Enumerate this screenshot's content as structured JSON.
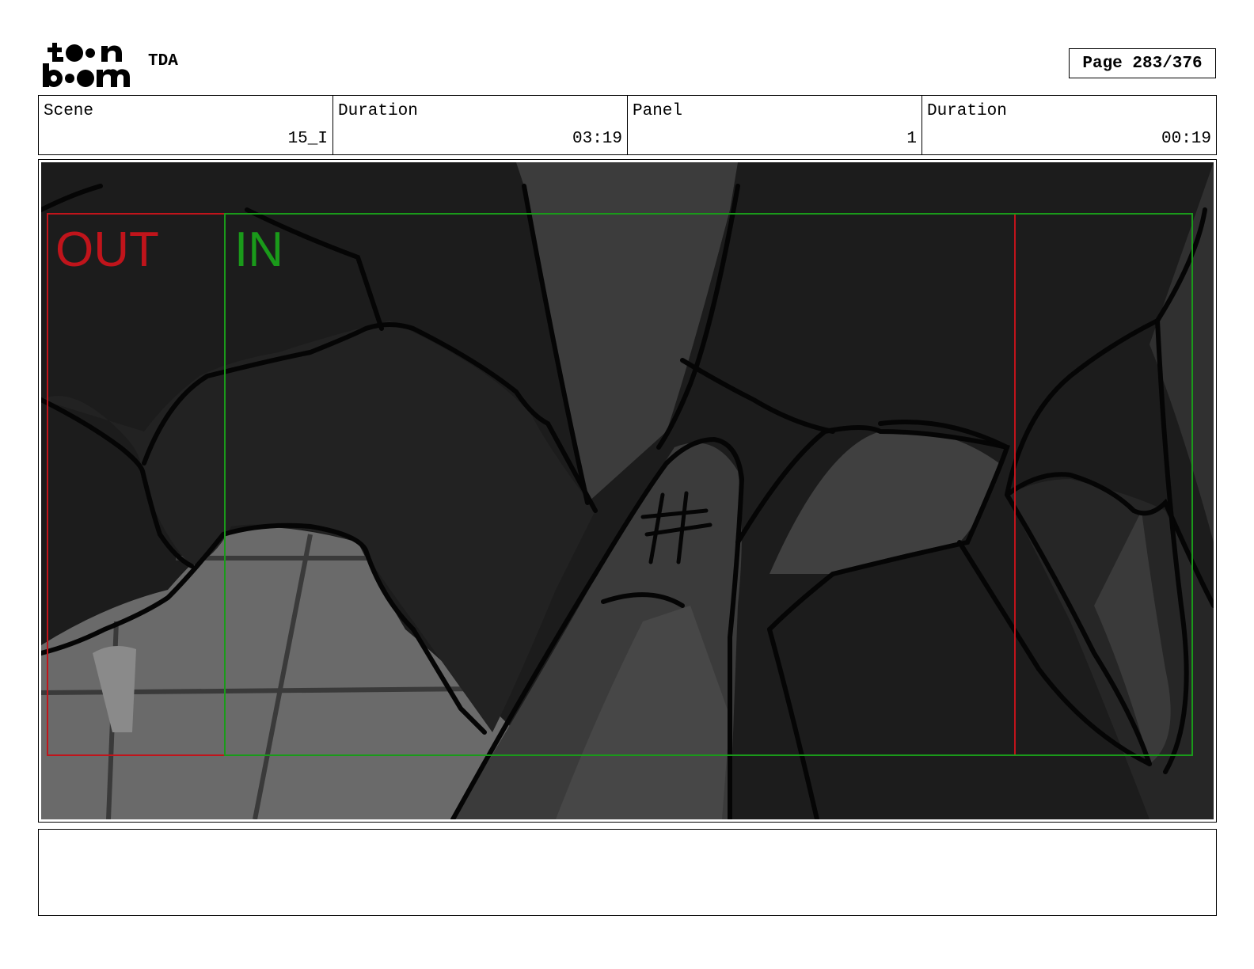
{
  "header": {
    "logo_text": "toon boom",
    "project": "TDA",
    "page_label": "Page 283/376"
  },
  "info": {
    "scene_label": "Scene",
    "scene_value": "15_I",
    "scene_duration_label": "Duration",
    "scene_duration_value": "03:19",
    "panel_label": "Panel",
    "panel_value": "1",
    "panel_duration_label": "Duration",
    "panel_duration_value": "00:19"
  },
  "panel": {
    "out_label": "OUT",
    "in_label": "IN",
    "finger_mark": "#",
    "colors": {
      "out_frame": "#c0141b",
      "in_frame": "#1a9a1a",
      "background": "#1c1c1c",
      "floor": "#6a6a6a",
      "finger": "#3a3a3a"
    }
  },
  "notes": {
    "text": ""
  }
}
